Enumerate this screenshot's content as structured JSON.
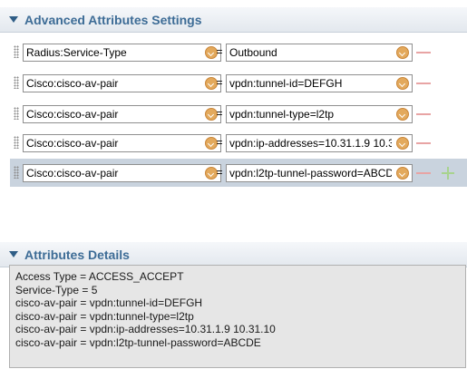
{
  "advanced_section": {
    "title": "Advanced Attributes Settings",
    "rows": [
      {
        "attribute": "Radius:Service-Type",
        "operator": "=",
        "value": "Outbound"
      },
      {
        "attribute": "Cisco:cisco-av-pair",
        "operator": "=",
        "value": "vpdn:tunnel-id=DEFGH"
      },
      {
        "attribute": "Cisco:cisco-av-pair",
        "operator": "=",
        "value": "vpdn:tunnel-type=l2tp"
      },
      {
        "attribute": "Cisco:cisco-av-pair",
        "operator": "=",
        "value": "vpdn:ip-addresses=10.31.1.9 10.3"
      },
      {
        "attribute": "Cisco:cisco-av-pair",
        "operator": "=",
        "value": "vpdn:l2tp-tunnel-password=ABCD"
      }
    ]
  },
  "details_section": {
    "title": "Attributes Details",
    "lines": [
      "Access Type = ACCESS_ACCEPT",
      "Service-Type = 5",
      "cisco-av-pair = vpdn:tunnel-id=DEFGH",
      "cisco-av-pair = vpdn:tunnel-type=l2tp",
      "cisco-av-pair = vpdn:ip-addresses=10.31.1.9 10.31.10",
      "cisco-av-pair = vpdn:l2tp-tunnel-password=ABCDE"
    ]
  },
  "colors": {
    "header_title": "#3d6c96",
    "dropdown_button": "#e3a95c",
    "remove_icon": "#e8a4a4",
    "add_icon": "#a8d38e",
    "selected_row": "#c9d3de",
    "details_background": "#e6e6e6"
  },
  "icons": {
    "collapse": "chevron-down-icon",
    "drag": "drag-handle-icon",
    "dropdown": "dropdown-arrow-icon",
    "remove": "minus-icon",
    "add": "plus-icon"
  }
}
